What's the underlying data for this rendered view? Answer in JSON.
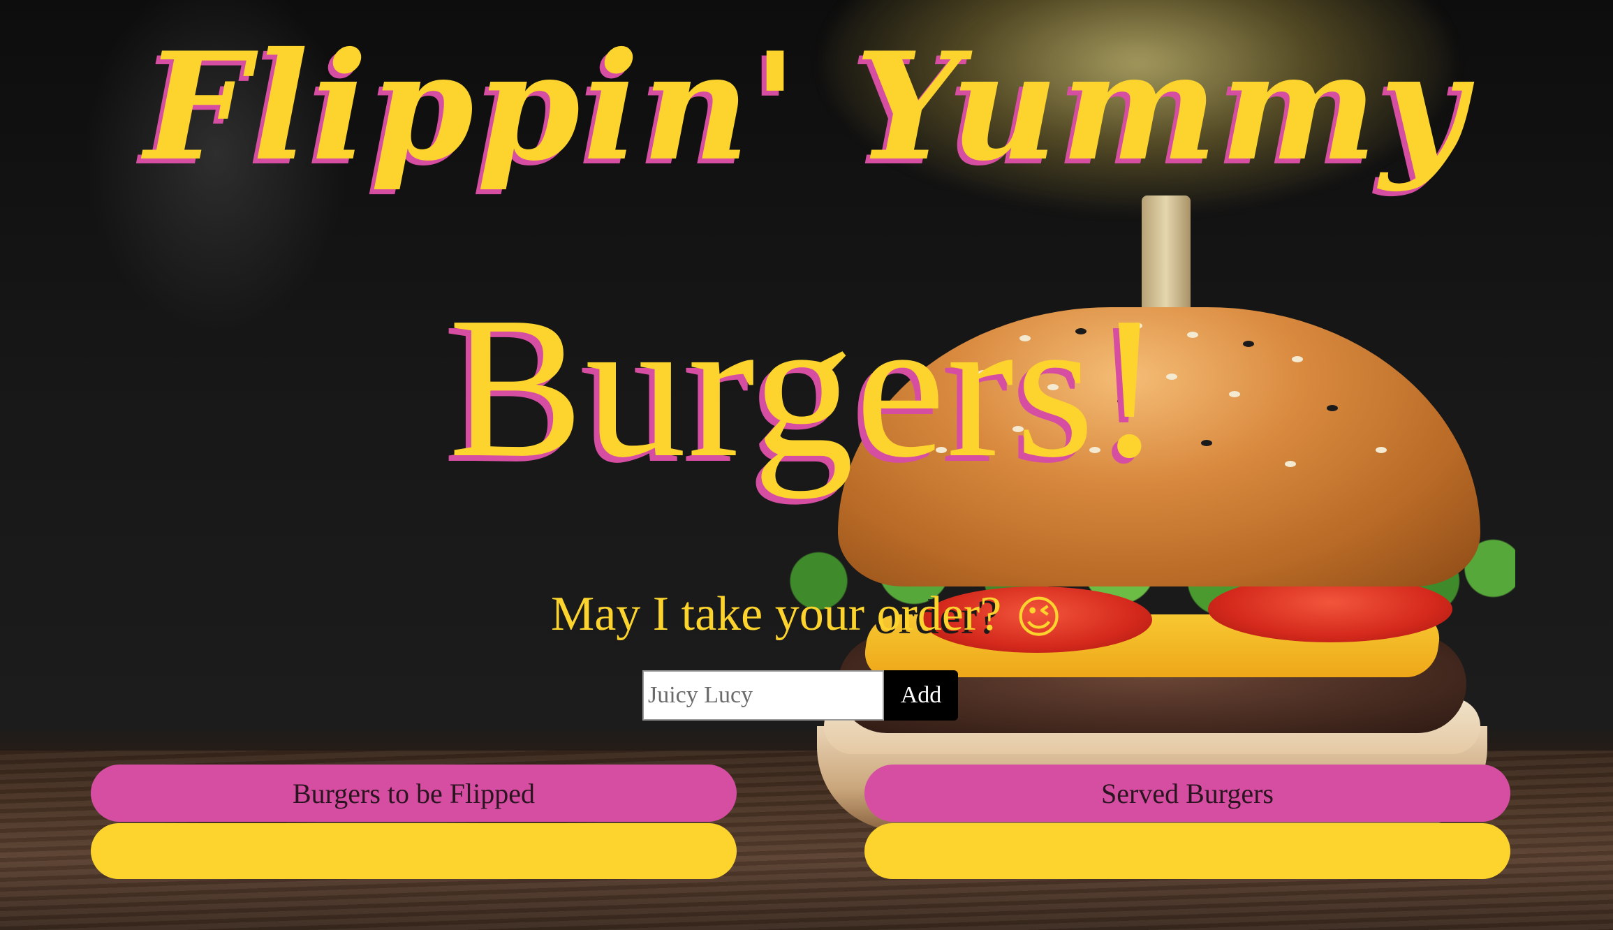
{
  "header": {
    "title_line1": "Flippin' Yummy",
    "title_line2": "Burgers!"
  },
  "order": {
    "prompt": "May I take your order?",
    "prompt_emoji": "😉",
    "input_placeholder": "Juicy Lucy",
    "input_value": "",
    "add_label": "Add"
  },
  "columns": {
    "to_flip": {
      "header": "Burgers to be Flipped",
      "items": []
    },
    "served": {
      "header": "Served Burgers",
      "items": []
    }
  },
  "colors": {
    "title_yellow": "#fdd42e",
    "title_pink_shadow": "#d64ea2",
    "header_pink": "#d64ea2",
    "body_yellow": "#fdd42e",
    "button_black": "#000000"
  },
  "background": {
    "subject": "burger-photo"
  }
}
